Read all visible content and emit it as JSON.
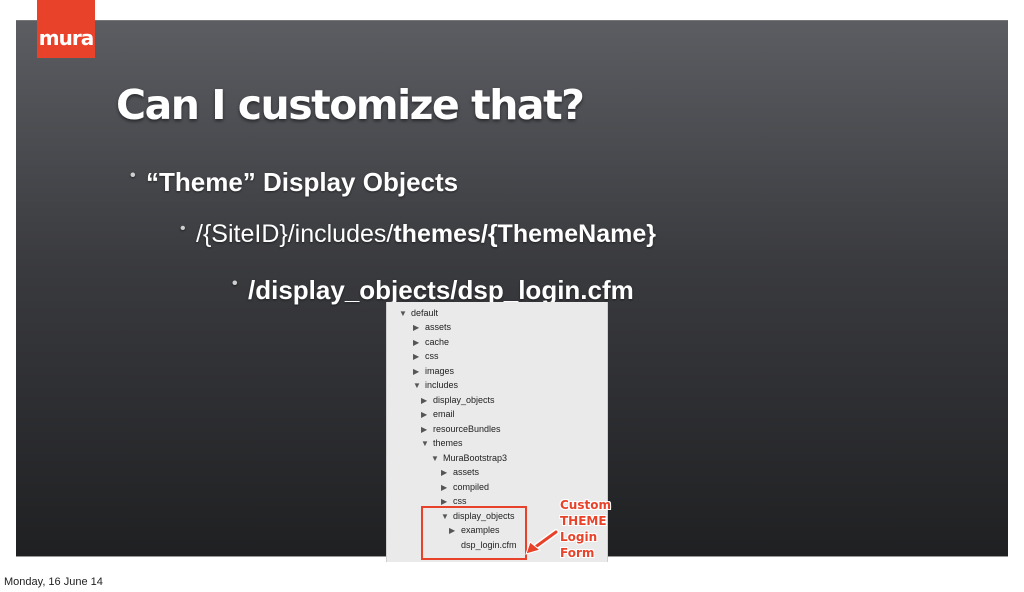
{
  "logo": {
    "brand": "mura"
  },
  "slide": {
    "title": "Can I customize that?",
    "bullets": {
      "b1": "“Theme” Display Objects",
      "b2_normal": "/{SiteID}/includes/",
      "b2_bold": "themes/{ThemeName}",
      "b3": "/display_objects/dsp_login.cfm"
    }
  },
  "tree": {
    "rows": [
      {
        "label": "default",
        "expanded": true
      },
      {
        "label": "assets",
        "expanded": false
      },
      {
        "label": "cache",
        "expanded": false
      },
      {
        "label": "css",
        "expanded": false
      },
      {
        "label": "images",
        "expanded": false
      },
      {
        "label": "includes",
        "expanded": true
      },
      {
        "label": "display_objects",
        "expanded": false
      },
      {
        "label": "email",
        "expanded": false
      },
      {
        "label": "resourceBundles",
        "expanded": false
      },
      {
        "label": "themes",
        "expanded": true
      },
      {
        "label": "MuraBootstrap3",
        "expanded": true
      },
      {
        "label": "assets",
        "expanded": false
      },
      {
        "label": "compiled",
        "expanded": false
      },
      {
        "label": "css",
        "expanded": false
      },
      {
        "label": "display_objects",
        "expanded": true
      },
      {
        "label": "examples",
        "expanded": false
      },
      {
        "label": "dsp_login.cfm",
        "expanded": null
      }
    ]
  },
  "callout": {
    "line1": "Custom",
    "line2": "THEME",
    "line3": "Login",
    "line4": "Form"
  },
  "footer": {
    "date": "Monday, 16 June 14"
  },
  "colors": {
    "accent": "#e8432a",
    "slide_top": "#5b5d62",
    "slide_bottom": "#1f2022"
  }
}
